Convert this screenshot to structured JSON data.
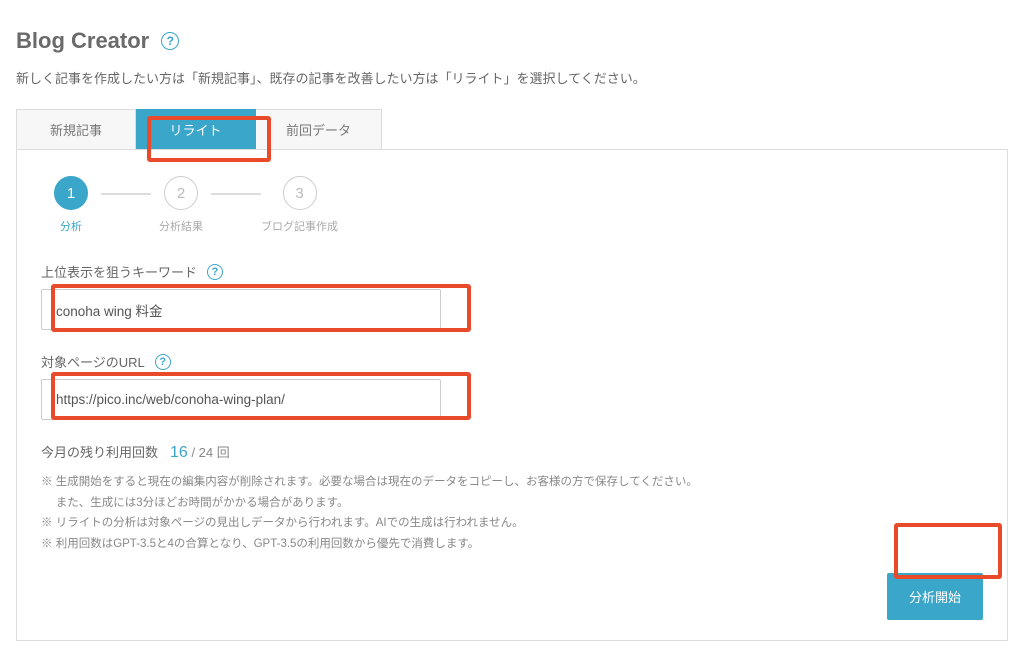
{
  "header": {
    "title": "Blog Creator"
  },
  "subtitle": "新しく記事を作成したい方は「新規記事」、既存の記事を改善したい方は「リライト」を選択してください。",
  "tabs": {
    "new_article": "新規記事",
    "rewrite": "リライト",
    "previous": "前回データ"
  },
  "steps": [
    {
      "num": "1",
      "label": "分析"
    },
    {
      "num": "2",
      "label": "分析結果"
    },
    {
      "num": "3",
      "label": "ブログ記事作成"
    }
  ],
  "fields": {
    "keyword": {
      "label": "上位表示を狙うキーワード",
      "value": "conoha wing 料金"
    },
    "url": {
      "label": "対象ページのURL",
      "value": "https://pico.inc/web/conoha-wing-plan/"
    }
  },
  "usage": {
    "label": "今月の残り利用回数",
    "count": "16",
    "total": "/ 24 回"
  },
  "notes": [
    "※ 生成開始をすると現在の編集内容が削除されます。必要な場合は現在のデータをコピーし、お客様の方で保存してください。",
    "　 また、生成には3分ほどお時間がかかる場合があります。",
    "※ リライトの分析は対象ページの見出しデータから行われます。AIでの生成は行われません。",
    "※ 利用回数はGPT-3.5と4の合算となり、GPT-3.5の利用回数から優先で消費します。"
  ],
  "actions": {
    "analyze": "分析開始"
  }
}
